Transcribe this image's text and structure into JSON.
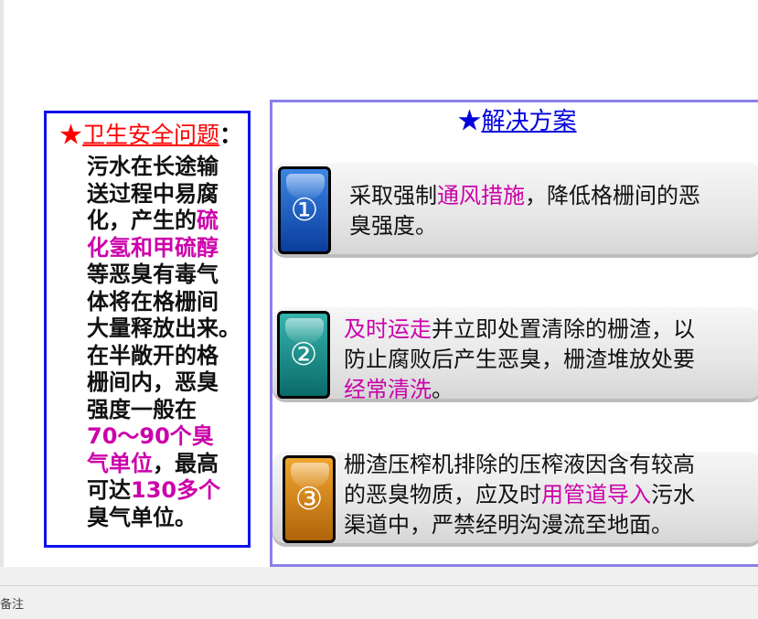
{
  "left_panel": {
    "title_star": "★",
    "title": "卫生安全问题",
    "title_colon": "：",
    "lines": [
      [
        {
          "t": "污水在长途输",
          "c": "n"
        }
      ],
      [
        {
          "t": "送过程中易腐",
          "c": "n"
        }
      ],
      [
        {
          "t": "化，产生的",
          "c": "n"
        },
        {
          "t": "硫",
          "c": "m"
        }
      ],
      [
        {
          "t": "化氢和甲硫醇",
          "c": "m"
        }
      ],
      [
        {
          "t": "等恶臭有毒气",
          "c": "n"
        }
      ],
      [
        {
          "t": "体将在格栅间",
          "c": "n"
        }
      ],
      [
        {
          "t": "大量释放出来。",
          "c": "n"
        }
      ],
      [
        {
          "t": "在半敞开的格",
          "c": "n"
        }
      ],
      [
        {
          "t": "栅间内，恶臭",
          "c": "n"
        }
      ],
      [
        {
          "t": "强度一般在",
          "c": "n"
        }
      ],
      [
        {
          "t": "70～90个臭",
          "c": "m"
        }
      ],
      [
        {
          "t": "气单位",
          "c": "m"
        },
        {
          "t": "，最高",
          "c": "n"
        }
      ],
      [
        {
          "t": "可达",
          "c": "n"
        },
        {
          "t": "130多个",
          "c": "m"
        }
      ],
      [
        {
          "t": "臭气单位。",
          "c": "n"
        }
      ]
    ]
  },
  "right_panel": {
    "title_star": "★",
    "title": "解决方案",
    "items": [
      {
        "badge": "①",
        "color": "#0a3d9c",
        "lines": [
          [
            {
              "t": "采取强制",
              "c": "n"
            },
            {
              "t": "通风措施",
              "c": "m"
            },
            {
              "t": "，降低格栅间的恶",
              "c": "n"
            }
          ],
          [
            {
              "t": "臭强度。",
              "c": "n"
            }
          ]
        ]
      },
      {
        "badge": "②",
        "color": "#0a6b69",
        "lines": [
          [
            {
              "t": "及时运走",
              "c": "m"
            },
            {
              "t": "并立即处置清除的栅渣，以",
              "c": "n"
            }
          ],
          [
            {
              "t": "防止腐败后产生恶臭，栅渣堆放处要",
              "c": "n"
            }
          ],
          [
            {
              "t": "经常清洗",
              "c": "m"
            },
            {
              "t": "。",
              "c": "n"
            }
          ]
        ]
      },
      {
        "badge": "③",
        "color": "#b0640a",
        "lines": [
          [
            {
              "t": "栅渣压榨机排除的压榨液因含有较高",
              "c": "n"
            }
          ],
          [
            {
              "t": "的恶臭物质，应及时",
              "c": "n"
            },
            {
              "t": "用管道导入",
              "c": "m"
            },
            {
              "t": "污水",
              "c": "n"
            }
          ],
          [
            {
              "t": "渠道中，严禁经明沟漫流至地面。",
              "c": "n"
            }
          ]
        ]
      }
    ]
  },
  "status_bar": {
    "notes_label": "备注"
  },
  "colors": {
    "highlight": "#cc00aa",
    "left_border": "#1010ee",
    "right_border": "#8b7fe8",
    "title_red": "#ff0000",
    "title_blue": "#0000dd"
  }
}
